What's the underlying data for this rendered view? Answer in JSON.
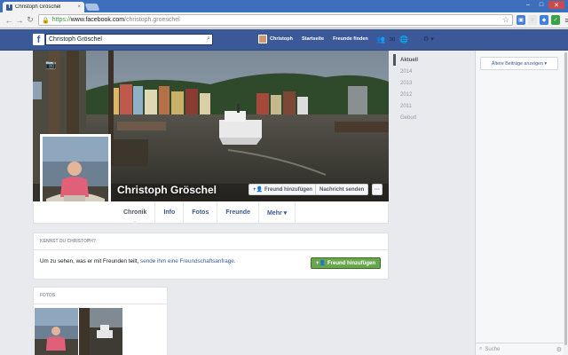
{
  "browser": {
    "tab_title": "Christoph Gröschel",
    "tab_close": "×",
    "url_scheme": "https://",
    "url_host": "www.facebook.com",
    "url_path": "/christoph.groeschel"
  },
  "fb": {
    "logo": "f",
    "search_value": "Christoph Gröschel",
    "nav": {
      "profile": "Christoph",
      "home": "Startseite",
      "find_friends": "Freunde finden"
    }
  },
  "profile": {
    "name": "Christoph Gröschel",
    "add_friend": "Freund hinzufügen",
    "send_message": "Nachricht senden",
    "more": "···",
    "tabs": [
      "Chronik",
      "Info",
      "Fotos",
      "Freunde",
      "Mehr ▾"
    ]
  },
  "know": {
    "header": "KENNST DU CHRISTOPH?",
    "text": "Um zu sehen, was er mit Freunden teilt, ",
    "link": "sende ihm eine Freundschaftsanfrage.",
    "button": "Freund hinzufügen"
  },
  "photos": {
    "header": "FOTOS"
  },
  "timeline_years": [
    "Aktuell",
    "2014",
    "2013",
    "2012",
    "2011",
    "Geburt"
  ],
  "sidebar": {
    "older_posts": "Ältere Beiträge anzeigen ▾",
    "chat_search": "Suche"
  },
  "colors": {
    "fb_blue": "#3b5998",
    "green": "#69a74e"
  }
}
